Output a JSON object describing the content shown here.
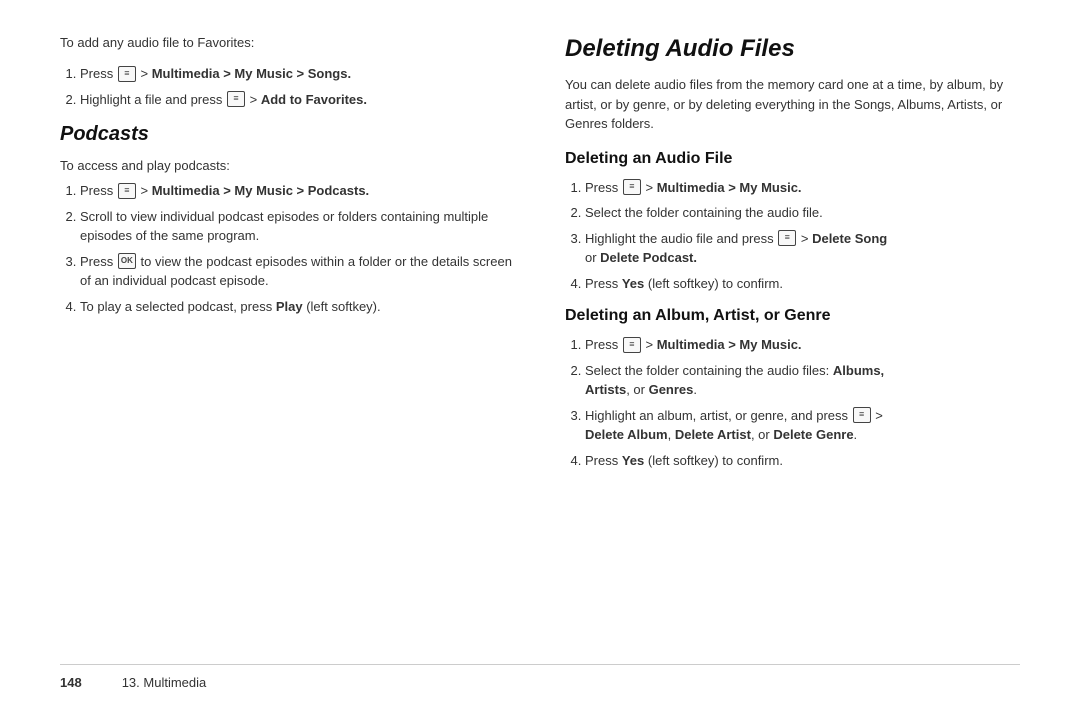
{
  "footer": {
    "page_number": "148",
    "chapter": "13. Multimedia"
  },
  "left": {
    "intro_label": "To add any audio file to Favorites:",
    "step1_prefix": "Press",
    "step1_nav": " > Multimedia > My Music > Songs.",
    "step2_prefix": "Highlight a file and press",
    "step2_nav": " > ",
    "step2_bold": "Add to Favorites.",
    "podcasts_title": "Podcasts",
    "podcasts_label": "To access and play podcasts:",
    "p_step1_prefix": "Press",
    "p_step1_nav": " > Multimedia > My Music > Podcasts.",
    "p_step2": "Scroll to view individual podcast episodes or folders containing multiple episodes of the same program.",
    "p_step3_prefix": "Press",
    "p_step3_mid": " to view the podcast episodes within a folder or the details screen of an individual podcast episode.",
    "p_step4": "To play a selected podcast, press Play (left softkey).",
    "play_bold": "Play"
  },
  "right": {
    "title": "Deleting Audio Files",
    "description": "You can delete audio files from the memory card one at a time, by album, by artist, or by genre, or by deleting everything in the Songs, Albums, Artists, or Genres folders.",
    "audio_file_title": "Deleting an Audio File",
    "af_step1_prefix": "Press",
    "af_step1_nav": " > Multimedia > My Music.",
    "af_step2": "Select the folder containing the audio file.",
    "af_step3_prefix": "Highlight the audio file and press",
    "af_step3_nav": " > Delete Song",
    "af_step3_suffix": "or Delete Podcast.",
    "af_step3_bold1": "Delete Song",
    "af_step3_bold2": "Delete Podcast.",
    "af_step4": "Press Yes (left softkey) to confirm.",
    "af_step4_bold": "Yes",
    "album_title": "Deleting an Album, Artist, or Genre",
    "al_step1_prefix": "Press",
    "al_step1_nav": " > Multimedia > My Music.",
    "al_step2_prefix": "Select the folder containing the audio files:",
    "al_step2_bold1": "Albums,",
    "al_step2_bold2": "Artists",
    "al_step2_mid": ", or",
    "al_step2_bold3": "Genres",
    "al_step2_suffix": ".",
    "al_step3_prefix": "Highlight an album, artist, or genre, and press",
    "al_step3_nav": " > ",
    "al_step3_bold1": "Delete Album",
    "al_step3_bold2": "Delete Artist",
    "al_step3_bold3": "Delete Genre",
    "al_step4": "Press Yes (left softkey) to confirm.",
    "al_step4_bold": "Yes"
  }
}
